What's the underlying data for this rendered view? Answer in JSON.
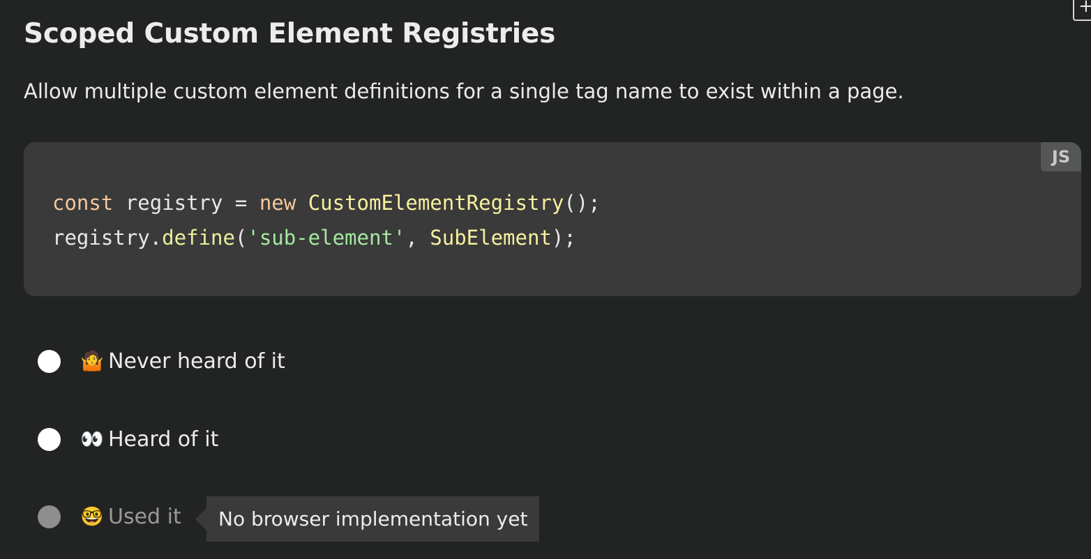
{
  "corner_button": {
    "icon": "plus-icon",
    "glyph": "+"
  },
  "feature": {
    "title": "Scoped Custom Element Registries",
    "description": "Allow multiple custom element definitions for a single tag name to exist within a page."
  },
  "code_block": {
    "language": "JS",
    "lines": [
      [
        {
          "text": "const",
          "kind": "kw"
        },
        {
          "text": " registry = ",
          "kind": "plain"
        },
        {
          "text": "new",
          "kind": "kw"
        },
        {
          "text": " ",
          "kind": "plain"
        },
        {
          "text": "CustomElementRegistry",
          "kind": "cls"
        },
        {
          "text": "();",
          "kind": "plain"
        }
      ],
      [
        {
          "text": "registry.",
          "kind": "plain"
        },
        {
          "text": "define",
          "kind": "fn"
        },
        {
          "text": "(",
          "kind": "plain"
        },
        {
          "text": "'sub-element'",
          "kind": "str"
        },
        {
          "text": ", ",
          "kind": "plain"
        },
        {
          "text": "SubElement",
          "kind": "cls"
        },
        {
          "text": ");",
          "kind": "plain"
        }
      ]
    ]
  },
  "options": [
    {
      "emoji": "🤷",
      "label": "Never heard of it",
      "disabled": false,
      "selected": false
    },
    {
      "emoji": "👀",
      "label": "Heard of it",
      "disabled": false,
      "selected": false
    },
    {
      "emoji": "🤓",
      "label": "Used it",
      "disabled": true,
      "selected": false
    }
  ],
  "tooltip": {
    "text": "No browser implementation yet"
  },
  "colors": {
    "background": "#222323",
    "code_background": "#3a3a3a",
    "keyword": "#f4c79c",
    "class_name": "#f7f0a0",
    "string": "#a6e9a0"
  }
}
